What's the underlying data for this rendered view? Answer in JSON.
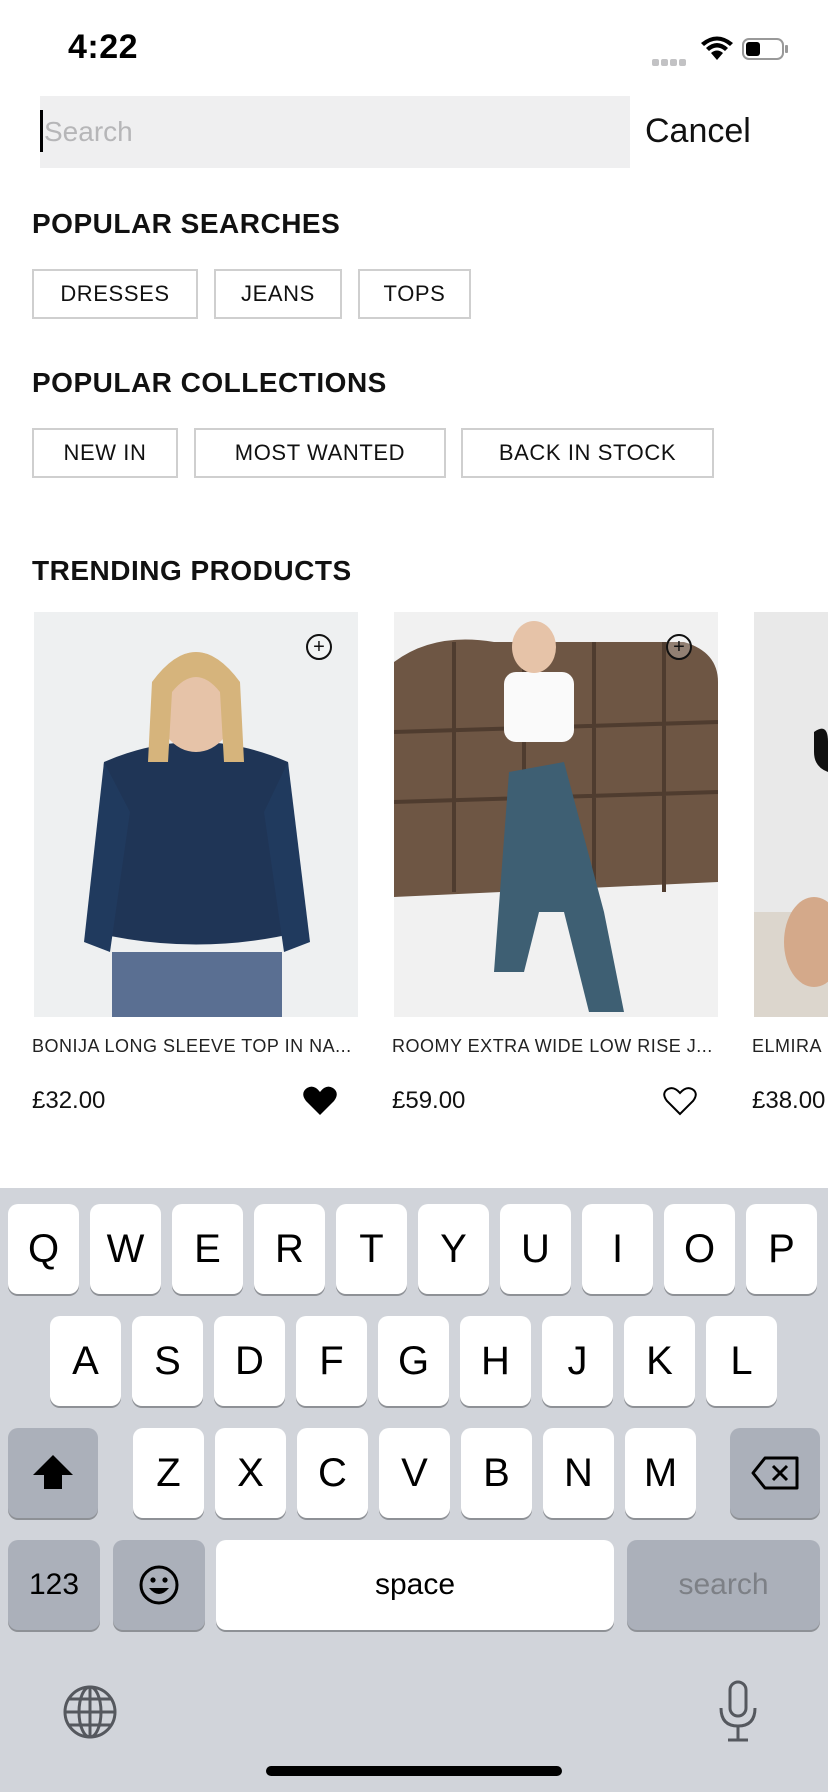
{
  "status_bar": {
    "time": "4:22"
  },
  "search": {
    "placeholder": "Search",
    "value": "",
    "cancel_label": "Cancel"
  },
  "popular_searches": {
    "title": "POPULAR SEARCHES",
    "items": [
      "DRESSES",
      "JEANS",
      "TOPS"
    ]
  },
  "popular_collections": {
    "title": "POPULAR COLLECTIONS",
    "items": [
      "NEW IN",
      "MOST WANTED",
      "BACK IN STOCK"
    ]
  },
  "trending": {
    "title": "TRENDING PRODUCTS",
    "products": [
      {
        "title": "BONIJA LONG SLEEVE TOP IN NA...",
        "price": "£32.00",
        "favorited": true
      },
      {
        "title": "ROOMY EXTRA WIDE LOW RISE J...",
        "price": "£59.00",
        "favorited": false
      },
      {
        "title": "ELMIRA",
        "price": "£38.00",
        "favorited": false
      }
    ]
  },
  "keyboard": {
    "row1": [
      "Q",
      "W",
      "E",
      "R",
      "T",
      "Y",
      "U",
      "I",
      "O",
      "P"
    ],
    "row2": [
      "A",
      "S",
      "D",
      "F",
      "G",
      "H",
      "J",
      "K",
      "L"
    ],
    "row3": [
      "Z",
      "X",
      "C",
      "V",
      "B",
      "N",
      "M"
    ],
    "numbers_label": "123",
    "space_label": "space",
    "search_label": "search",
    "icons": {
      "shift": "shift-icon",
      "delete": "delete-icon",
      "emoji": "emoji-icon",
      "globe": "globe-icon",
      "mic": "microphone-icon"
    }
  },
  "colors": {
    "keyboard_bg": "#d1d4da",
    "search_bg": "#efeff0",
    "chip_border": "#cfcfcf"
  }
}
